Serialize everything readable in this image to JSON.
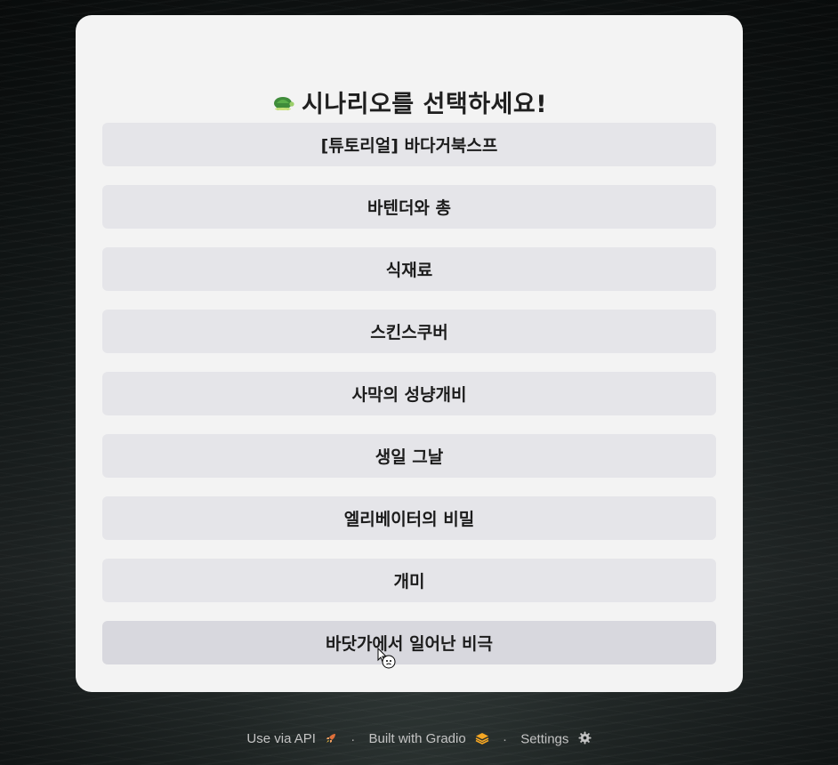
{
  "header": {
    "title": "시나리오를 선택하세요!",
    "icon": "turtle-icon"
  },
  "scenarios": [
    {
      "label": "[튜토리얼] 바다거북스프"
    },
    {
      "label": "바텐더와 총"
    },
    {
      "label": "식재료"
    },
    {
      "label": "스킨스쿠버"
    },
    {
      "label": "사막의 성냥개비"
    },
    {
      "label": "생일 그날"
    },
    {
      "label": "엘리베이터의 비밀"
    },
    {
      "label": "개미"
    },
    {
      "label": "바닷가에서 일어난 비극"
    }
  ],
  "footer": {
    "api_label": "Use via API",
    "api_icon": "rocket-icon",
    "gradio_label": "Built with Gradio",
    "gradio_icon": "gradio-logo-icon",
    "settings_label": "Settings",
    "settings_icon": "gear-icon",
    "separator": "·"
  },
  "colors": {
    "card_bg": "#f3f3f3",
    "button_bg": "#e5e5e9",
    "button_hover_bg": "#d8d8de",
    "footer_text": "#c4c4c4"
  }
}
